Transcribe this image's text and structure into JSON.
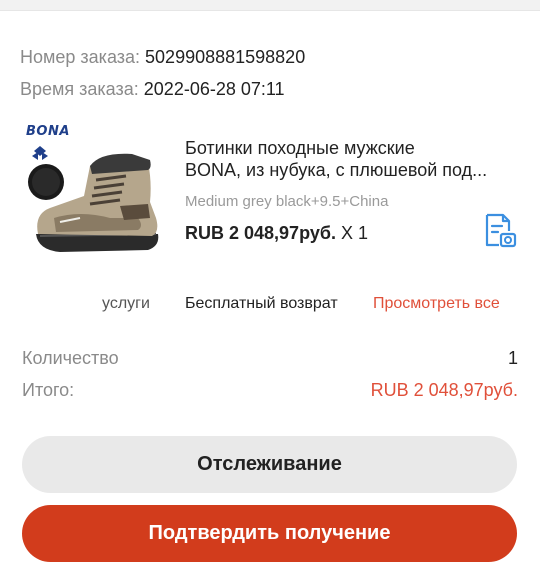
{
  "order": {
    "number_label": "Номер заказа:",
    "number_value": "5029908881598820",
    "time_label": "Время заказа:",
    "time_value": "2022-06-28 07:11"
  },
  "product": {
    "brand": "BONA",
    "title_line1": "Ботинки походные мужские",
    "title_line2": "BONA, из нубука, с плюшевой под...",
    "variant": "Medium grey black+9.5+China",
    "price": "RUB 2 048,97руб.",
    "quantity_text": "X 1"
  },
  "services": {
    "label": "услуги",
    "value": "Бесплатный возврат",
    "link": "Просмотреть все"
  },
  "summary": {
    "qty_label": "Количество",
    "qty_value": "1",
    "total_label": "Итого:",
    "total_value": "RUB 2 048,97руб."
  },
  "buttons": {
    "track": "Отслеживание",
    "confirm": "Подтвердить получение"
  },
  "colors": {
    "accent": "#d23c1c",
    "link": "#e0503a",
    "invoice_icon": "#3b8fe0"
  },
  "icons": {
    "invoice": "invoice-icon"
  }
}
